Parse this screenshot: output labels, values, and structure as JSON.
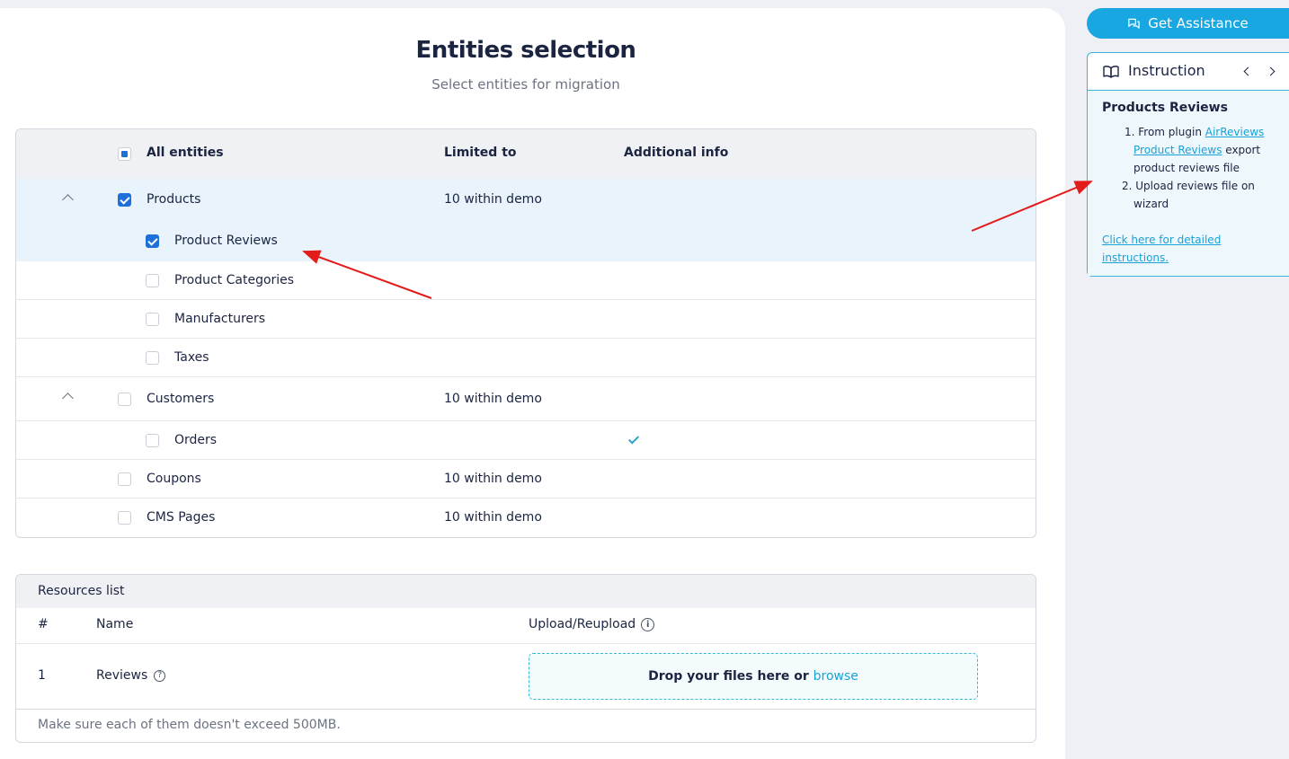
{
  "header": {
    "title": "Entities selection",
    "subtitle": "Select entities for migration"
  },
  "entities_table": {
    "columns": {
      "entity": "All entities",
      "limited": "Limited to",
      "additional": "Additional info"
    },
    "rows": [
      {
        "label": "Products",
        "limited": "10 within demo",
        "checked": true,
        "expanded": true
      },
      {
        "label": "Product Reviews",
        "checked": true
      },
      {
        "label": "Product Categories",
        "checked": false
      },
      {
        "label": "Manufacturers",
        "checked": false
      },
      {
        "label": "Taxes",
        "checked": false
      },
      {
        "label": "Customers",
        "limited": "10 within demo",
        "checked": false,
        "expanded": true
      },
      {
        "label": "Orders",
        "checked": false,
        "additional_check": true
      },
      {
        "label": "Coupons",
        "limited": "10 within demo",
        "checked": false
      },
      {
        "label": "CMS Pages",
        "limited": "10 within demo",
        "checked": false
      }
    ]
  },
  "resources": {
    "title": "Resources list",
    "columns": {
      "num": "#",
      "name": "Name",
      "upload": "Upload/Reupload"
    },
    "rows": [
      {
        "num": "1",
        "name": "Reviews"
      }
    ],
    "dropzone": {
      "text": "Drop your files here or",
      "browse": "browse"
    },
    "footer_note": "Make sure each of them doesn't exceed 500MB."
  },
  "sidebar": {
    "assist_label": "Get Assistance",
    "instruction": {
      "title": "Instruction",
      "section_title": "Products Reviews",
      "step1_prefix": "1. From plugin ",
      "step1_link1": "AirReviews",
      "step1_link2": "Product Reviews",
      "step1_mid": " export",
      "step1_line3": "product reviews file",
      "step2_line1": "2. Upload reviews file on",
      "step2_line2": "wizard",
      "details_link_line1": "Click here for detailed",
      "details_link_line2": "instructions."
    }
  },
  "colors": {
    "accent": "#18a7e0",
    "checkbox": "#1f6fd9",
    "selected_row": "#e9f3fc",
    "annotation_arrow": "#e31b1b"
  }
}
